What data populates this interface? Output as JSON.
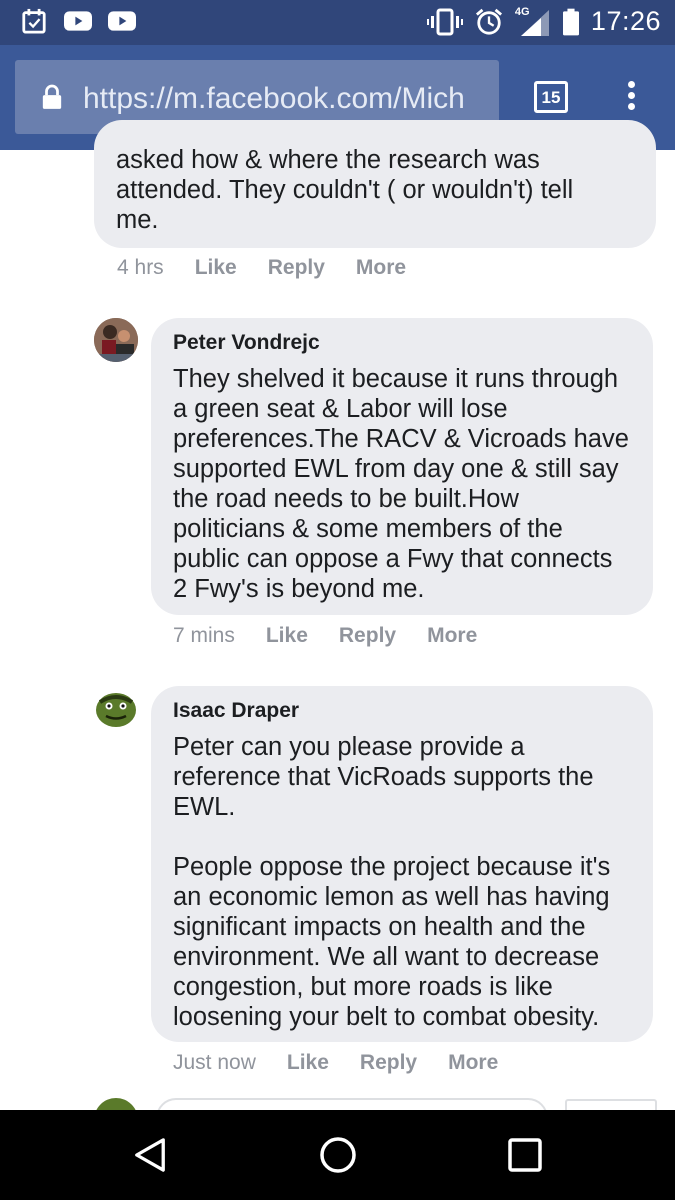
{
  "status_bar": {
    "time": "17:26",
    "network": "4G",
    "left_icons": [
      "calendar-icon",
      "youtube-icon",
      "youtube-icon"
    ],
    "right_icons": [
      "vibrate-icon",
      "alarm-icon",
      "signal-icon",
      "battery-icon"
    ]
  },
  "browser": {
    "url": "https://m.facebook.com/Mich",
    "tab_count": "15"
  },
  "comments": [
    {
      "author": "",
      "text": "asked how & where the research was\nattended. They couldn't ( or wouldn't) tell\nme.",
      "time": "4 hrs",
      "like": "Like",
      "reply": "Reply",
      "more": "More"
    },
    {
      "author": "Peter Vondrejc",
      "text": "They shelved it because it runs through\na green seat & Labor will lose\npreferences.The RACV & Vicroads have\nsupported EWL from day one & still say\nthe road needs to be built.How\npoliticians & some members of the\npublic can oppose a Fwy that connects\n2 Fwy's is beyond me.",
      "time": "7 mins",
      "like": "Like",
      "reply": "Reply",
      "more": "More"
    },
    {
      "author": "Isaac Draper",
      "text": "Peter can you please provide a\nreference that VicRoads supports the\nEWL.\n\nPeople oppose the project because it's\nan economic lemon as well has having\nsignificant impacts on health and the\nenvironment. We all want to decrease\ncongestion, but more roads is like\nloosening your belt to combat obesity.",
      "time": "Just now",
      "like": "Like",
      "reply": "Reply",
      "more": "More"
    }
  ],
  "colors": {
    "status_bar": "#30467a",
    "url_bar": "#3b5998",
    "bubble": "#ebecf0",
    "meta_text": "#90949c"
  }
}
